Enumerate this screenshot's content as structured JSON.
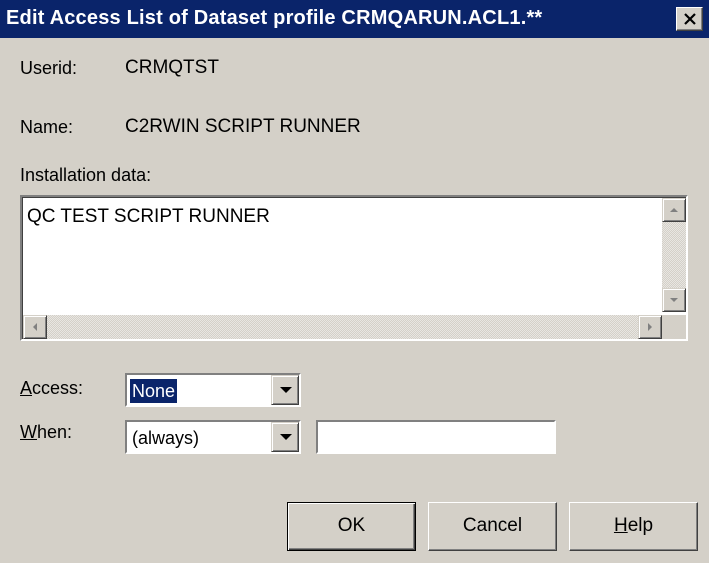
{
  "window": {
    "title": "Edit Access List of Dataset profile CRMQARUN.ACL1.**"
  },
  "fields": {
    "userid_label": "Userid:",
    "userid_value": "CRMQTST",
    "name_label": "Name:",
    "name_value": "C2RWIN SCRIPT RUNNER",
    "installation_label": "Installation data:",
    "installation_value": "QC TEST SCRIPT RUNNER"
  },
  "access": {
    "label_accel": "A",
    "label_rest": "ccess:",
    "selected": "None"
  },
  "when": {
    "label_accel": "W",
    "label_rest": "hen:",
    "selected": "(always)",
    "extra_value": ""
  },
  "buttons": {
    "ok": "OK",
    "cancel": "Cancel",
    "help_accel": "H",
    "help_rest": "elp"
  },
  "icons": {
    "close": "close-icon",
    "scroll_up": "arrow-up-icon",
    "scroll_down": "arrow-down-icon",
    "scroll_left": "arrow-left-icon",
    "scroll_right": "arrow-right-icon",
    "dropdown": "chevron-down-icon"
  },
  "colors": {
    "titlebar": "#0a246a",
    "face": "#d4d0c8",
    "selection": "#0a246a"
  }
}
